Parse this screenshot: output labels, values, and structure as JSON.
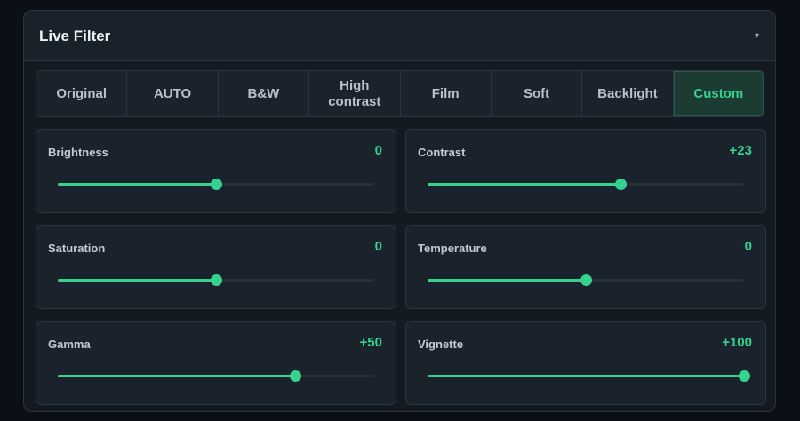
{
  "panel": {
    "title": "Live Filter",
    "collapse_icon": "▾"
  },
  "tabs": [
    {
      "label": "Original",
      "active": false
    },
    {
      "label": "AUTO",
      "active": false
    },
    {
      "label": "B&W",
      "active": false
    },
    {
      "label": "High contrast",
      "active": false
    },
    {
      "label": "Film",
      "active": false
    },
    {
      "label": "Soft",
      "active": false
    },
    {
      "label": "Backlight",
      "active": false
    },
    {
      "label": "Custom",
      "active": true
    }
  ],
  "sliders": [
    {
      "label": "Brightness",
      "value": "0",
      "level": 0.5
    },
    {
      "label": "Contrast",
      "value": "+23",
      "level": 0.61
    },
    {
      "label": "Saturation",
      "value": "0",
      "level": 0.5
    },
    {
      "label": "Temperature",
      "value": "0",
      "level": 0.5
    },
    {
      "label": "Gamma",
      "value": "+50",
      "level": 0.75
    },
    {
      "label": "Vignette",
      "value": "+100",
      "level": 1.0
    }
  ],
  "colors": {
    "accent": "#35d28f",
    "background": "#0c1016",
    "panel": "#131a22",
    "card": "#1a222c"
  }
}
